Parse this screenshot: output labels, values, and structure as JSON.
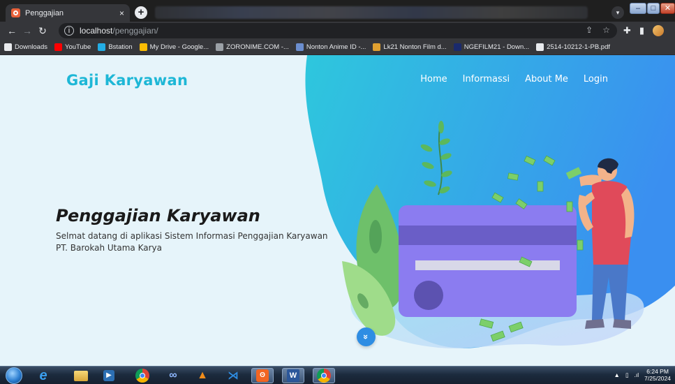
{
  "browser": {
    "tab_title": "Penggajian",
    "tab_close": "×",
    "new_tab": "+",
    "url_host": "localhost",
    "url_path": "/penggajian/",
    "bookmarks": [
      {
        "label": "Downloads",
        "icon": "download-icon",
        "color": "#e8eaed"
      },
      {
        "label": "YouTube",
        "icon": "youtube-icon",
        "color": "#ff0000"
      },
      {
        "label": "Bstation",
        "icon": "bstation-icon",
        "color": "#23ade5"
      },
      {
        "label": "My Drive - Google...",
        "icon": "drive-icon",
        "color": "#fbbc04"
      },
      {
        "label": "ZORONIME.COM -...",
        "icon": "zoronime-icon",
        "color": "#9aa0a6"
      },
      {
        "label": "Nonton Anime ID -...",
        "icon": "anime-icon",
        "color": "#6b8ecf"
      },
      {
        "label": "Lk21 Nonton Film d...",
        "icon": "lk21-icon",
        "color": "#e0a030"
      },
      {
        "label": "NGEFILM21 - Down...",
        "icon": "ngefilm-icon",
        "color": "#1a2a6c"
      },
      {
        "label": "2514-10212-1-PB.pdf",
        "icon": "chrome-icon",
        "color": "#e8eaed"
      }
    ]
  },
  "site": {
    "brand": "Gaji Karyawan",
    "nav": [
      "Home",
      "Informassi",
      "About Me",
      "Login"
    ],
    "hero_title": "Penggajian Karyawan",
    "hero_text": "Selmat datang di aplikasi Sistem Informasi Penggajian Karyawan PT. Barokah Utama Karya",
    "scroll_icon": "»"
  },
  "taskbar": {
    "time": "6:24 PM",
    "date": "7/25/2024"
  },
  "colors": {
    "brand": "#1eb7d6",
    "blob_start": "#2ec7dd",
    "blob_end": "#3a8ff0",
    "card": "#8b7cf0",
    "card_stripe": "#6a5ec7",
    "leaf": "#6ec06a",
    "scroll_btn": "#2e8de3"
  }
}
